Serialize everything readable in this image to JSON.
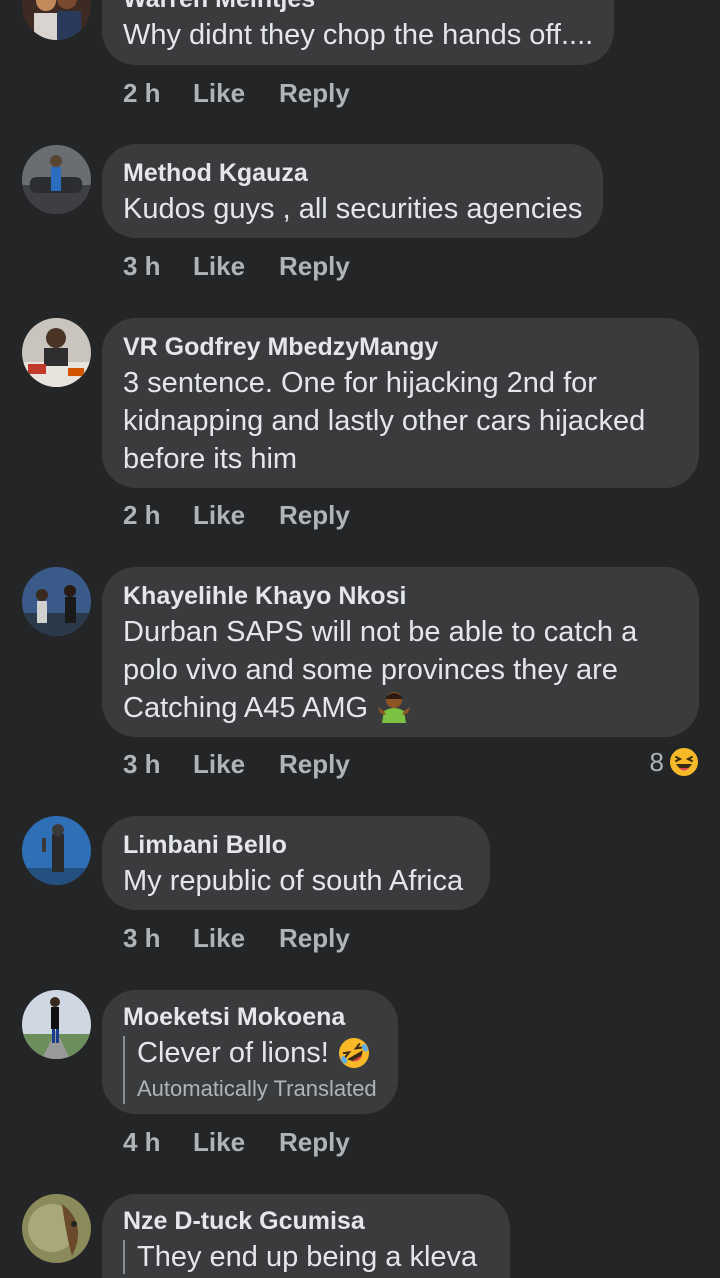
{
  "comments": [
    {
      "author": "Warren Meintjes",
      "text": "Why didnt they chop the hands off....",
      "time": "2 h",
      "like": "Like",
      "reply": "Reply"
    },
    {
      "author": "Method Kgauza",
      "text": "Kudos guys , all securities agencies",
      "time": "3 h",
      "like": "Like",
      "reply": "Reply"
    },
    {
      "author": "VR Godfrey MbedzyMangy",
      "text_lines": [
        "3 sentence. One for hijacking 2nd for",
        "kidnapping and lastly other cars hijacked",
        "before its him"
      ],
      "time": "2 h",
      "like": "Like",
      "reply": "Reply"
    },
    {
      "author": "Khayelihle Khayo Nkosi",
      "text_lines": [
        "Durban SAPS will not be able to catch a",
        "polo vivo and some provinces they are",
        "Catching A45 AMG"
      ],
      "emoji": "person-shrugging",
      "time": "3 h",
      "like": "Like",
      "reply": "Reply",
      "reaction_count": "8",
      "reaction_type": "haha"
    },
    {
      "author": "Limbani Bello",
      "text": "My republic of south Africa",
      "time": "3 h",
      "like": "Like",
      "reply": "Reply"
    },
    {
      "author": "Moeketsi Mokoena",
      "text": "Clever of lions!",
      "emoji": "rolling-on-floor-laughing",
      "translated_note": "Automatically Translated",
      "time": "4 h",
      "like": "Like",
      "reply": "Reply"
    },
    {
      "author": "Nze D-tuck Gcumisa",
      "text": "They end up being a kleva"
    }
  ],
  "colors": {
    "background": "#242526",
    "bubble": "#3a3b3c",
    "text_primary": "#e4e6eb",
    "text_secondary": "#b0b3b8",
    "haha_yellow": "#f7b928"
  }
}
